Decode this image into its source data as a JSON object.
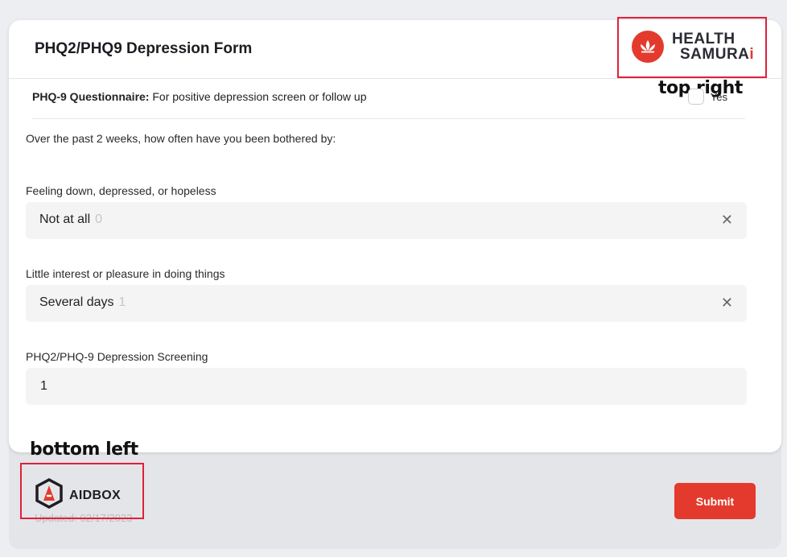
{
  "form": {
    "title": "PHQ2/PHQ9 Depression Form",
    "questionnaire": {
      "label_strong": "PHQ-9 Questionnaire:",
      "label_rest": "For positive depression screen or follow up",
      "checkbox_label": "Yes",
      "checked": false
    },
    "intro": "Over the past 2 weeks, how often have you been bothered by:",
    "questions": [
      {
        "label": "Feeling down, depressed, or hopeless",
        "value": "Not at all",
        "score": "0"
      },
      {
        "label": "Little interest or pleasure in doing things",
        "value": "Several days",
        "score": "1"
      }
    ],
    "screening": {
      "label": "PHQ2/PHQ-9 Depression Screening",
      "value": "1"
    }
  },
  "brand": {
    "line1": "HEALTH",
    "line2": "SAMURA",
    "dot": "i"
  },
  "annotations": {
    "top_right": "top right",
    "bottom_left": "bottom left"
  },
  "footer": {
    "logo_text": "AIDBOX",
    "updated": "Updated: 02/17/2023",
    "submit_label": "Submit"
  },
  "colors": {
    "accent": "#e33a2d",
    "annotation_box": "#e0203c"
  },
  "icons": {
    "clear": "close-icon",
    "brand": "lotus-icon",
    "aidbox": "aidbox-hexagon-icon"
  }
}
